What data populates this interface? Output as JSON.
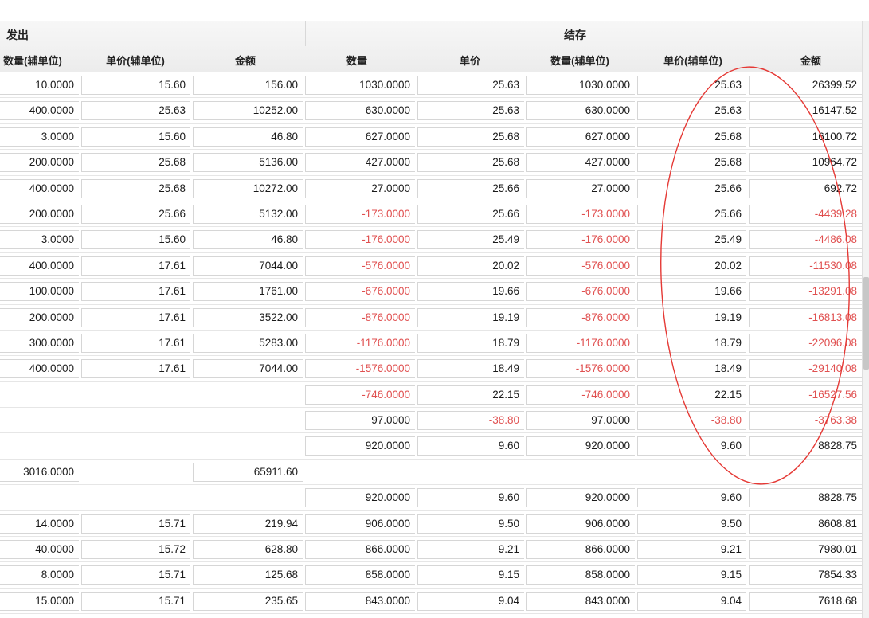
{
  "header": {
    "group_issue": "发出",
    "group_balance": "结存",
    "columns": [
      "数量(辅单位)",
      "单价(辅单位)",
      "金额",
      "数量",
      "单价",
      "数量(辅单位)",
      "单价(辅单位)",
      "金额"
    ]
  },
  "rows": [
    {
      "c": [
        "10.0000",
        "15.60",
        "156.00",
        "1030.0000",
        "25.63",
        "1030.0000",
        "25.63",
        "26399.52"
      ]
    },
    {
      "c": [
        "400.0000",
        "25.63",
        "10252.00",
        "630.0000",
        "25.63",
        "630.0000",
        "25.63",
        "16147.52"
      ]
    },
    {
      "c": [
        "3.0000",
        "15.60",
        "46.80",
        "627.0000",
        "25.68",
        "627.0000",
        "25.68",
        "16100.72"
      ]
    },
    {
      "c": [
        "200.0000",
        "25.68",
        "5136.00",
        "427.0000",
        "25.68",
        "427.0000",
        "25.68",
        "10964.72"
      ]
    },
    {
      "c": [
        "400.0000",
        "25.68",
        "10272.00",
        "27.0000",
        "25.66",
        "27.0000",
        "25.66",
        "692.72"
      ]
    },
    {
      "c": [
        "200.0000",
        "25.66",
        "5132.00",
        "-173.0000",
        "25.66",
        "-173.0000",
        "25.66",
        "-4439.28"
      ]
    },
    {
      "c": [
        "3.0000",
        "15.60",
        "46.80",
        "-176.0000",
        "25.49",
        "-176.0000",
        "25.49",
        "-4486.08"
      ]
    },
    {
      "c": [
        "400.0000",
        "17.61",
        "7044.00",
        "-576.0000",
        "20.02",
        "-576.0000",
        "20.02",
        "-11530.08"
      ]
    },
    {
      "c": [
        "100.0000",
        "17.61",
        "1761.00",
        "-676.0000",
        "19.66",
        "-676.0000",
        "19.66",
        "-13291.08"
      ]
    },
    {
      "c": [
        "200.0000",
        "17.61",
        "3522.00",
        "-876.0000",
        "19.19",
        "-876.0000",
        "19.19",
        "-16813.08"
      ]
    },
    {
      "c": [
        "300.0000",
        "17.61",
        "5283.00",
        "-1176.0000",
        "18.79",
        "-1176.0000",
        "18.79",
        "-22096.08"
      ]
    },
    {
      "c": [
        "400.0000",
        "17.61",
        "7044.00",
        "-1576.0000",
        "18.49",
        "-1576.0000",
        "18.49",
        "-29140.08"
      ]
    },
    {
      "c": [
        "",
        "",
        "",
        "-746.0000",
        "22.15",
        "-746.0000",
        "22.15",
        "-16527.56"
      ]
    },
    {
      "c": [
        "",
        "",
        "",
        "97.0000",
        "-38.80",
        "97.0000",
        "-38.80",
        "-3763.38"
      ]
    },
    {
      "c": [
        "",
        "",
        "",
        "920.0000",
        "9.60",
        "920.0000",
        "9.60",
        "8828.75"
      ]
    },
    {
      "c": [
        "3016.0000",
        "",
        "65911.60",
        "",
        "",
        "",
        "",
        ""
      ]
    },
    {
      "c": [
        "",
        "",
        "",
        "920.0000",
        "9.60",
        "920.0000",
        "9.60",
        "8828.75"
      ]
    },
    {
      "c": [
        "14.0000",
        "15.71",
        "219.94",
        "906.0000",
        "9.50",
        "906.0000",
        "9.50",
        "8608.81"
      ]
    },
    {
      "c": [
        "40.0000",
        "15.72",
        "628.80",
        "866.0000",
        "9.21",
        "866.0000",
        "9.21",
        "7980.01"
      ]
    },
    {
      "c": [
        "8.0000",
        "15.71",
        "125.68",
        "858.0000",
        "9.15",
        "858.0000",
        "9.15",
        "7854.33"
      ]
    },
    {
      "c": [
        "15.0000",
        "15.71",
        "235.65",
        "843.0000",
        "9.04",
        "843.0000",
        "9.04",
        "7618.68"
      ]
    }
  ],
  "colors": {
    "negative": "#e05050",
    "annotation": "#e53935"
  }
}
